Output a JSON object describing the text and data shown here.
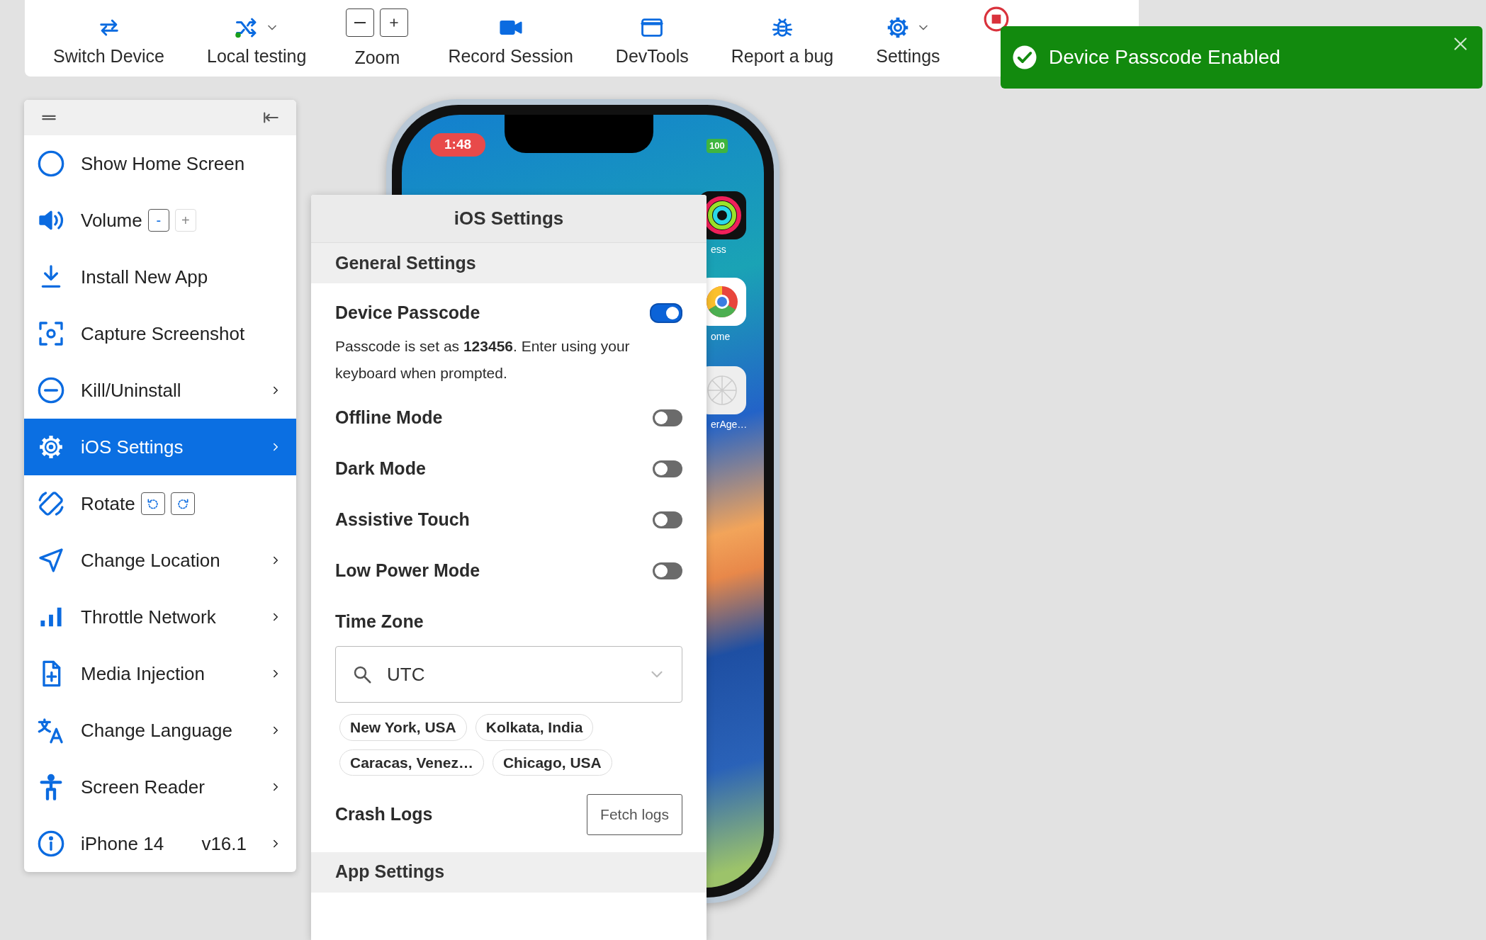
{
  "toolbar": {
    "items": [
      {
        "kind": "button",
        "label": "Switch Device"
      },
      {
        "kind": "menu",
        "label": "Local testing"
      },
      {
        "kind": "zoom",
        "label": "Zoom"
      },
      {
        "kind": "button",
        "label": "Record Session"
      },
      {
        "kind": "button",
        "label": "DevTools"
      },
      {
        "kind": "button",
        "label": "Report a bug"
      },
      {
        "kind": "menu",
        "label": "Settings"
      },
      {
        "kind": "stop"
      }
    ]
  },
  "sidebar": {
    "items": [
      {
        "kind": "plain",
        "label": "Show Home Screen",
        "selected": false,
        "submenu": false
      },
      {
        "kind": "stepper",
        "label": "Volume",
        "selected": false,
        "submenu": false,
        "controls": [
          {
            "label": "-",
            "disabled": false
          },
          {
            "label": "+",
            "disabled": true
          }
        ]
      },
      {
        "kind": "plain",
        "label": "Install New App",
        "selected": false,
        "submenu": false
      },
      {
        "kind": "plain",
        "label": "Capture Screenshot",
        "selected": false,
        "submenu": false
      },
      {
        "kind": "plain",
        "label": "Kill/Uninstall",
        "selected": false,
        "submenu": true
      },
      {
        "kind": "plain",
        "label": "iOS Settings",
        "selected": true,
        "submenu": true
      },
      {
        "kind": "rotate",
        "label": "Rotate",
        "selected": false,
        "submenu": false
      },
      {
        "kind": "plain",
        "label": "Change Location",
        "selected": false,
        "submenu": true
      },
      {
        "kind": "plain",
        "label": "Throttle Network",
        "selected": false,
        "submenu": true
      },
      {
        "kind": "plain",
        "label": "Media Injection",
        "selected": false,
        "submenu": true
      },
      {
        "kind": "plain",
        "label": "Change Language",
        "selected": false,
        "submenu": true
      },
      {
        "kind": "plain",
        "label": "Screen Reader",
        "selected": false,
        "submenu": true
      },
      {
        "kind": "info",
        "label": "iPhone 14",
        "detail": "v16.1",
        "selected": false,
        "submenu": true
      }
    ]
  },
  "device": {
    "time": "1:48",
    "battery": "100",
    "app_labels": [
      "ess",
      "ome",
      "erAge…"
    ]
  },
  "ios_settings": {
    "title": "iOS Settings",
    "general": {
      "title": "General Settings",
      "toggles": [
        {
          "label": "Device Passcode",
          "on": true,
          "description": "Passcode is set as **123456**. Enter using your keyboard when prompted."
        },
        {
          "label": "Offline Mode",
          "on": false
        },
        {
          "label": "Dark Mode",
          "on": false
        },
        {
          "label": "Assistive Touch",
          "on": false
        },
        {
          "label": "Low Power Mode",
          "on": false
        }
      ],
      "time_zone": {
        "label": "Time Zone",
        "value": "UTC",
        "chips": [
          "New York, USA",
          "Kolkata, India",
          "Caracas, Venez…",
          "Chicago, USA"
        ]
      },
      "crash_logs": {
        "label": "Crash Logs",
        "button": "Fetch logs"
      }
    },
    "app_settings": {
      "title": "App Settings"
    }
  },
  "toast": {
    "message": "Device Passcode Enabled"
  }
}
